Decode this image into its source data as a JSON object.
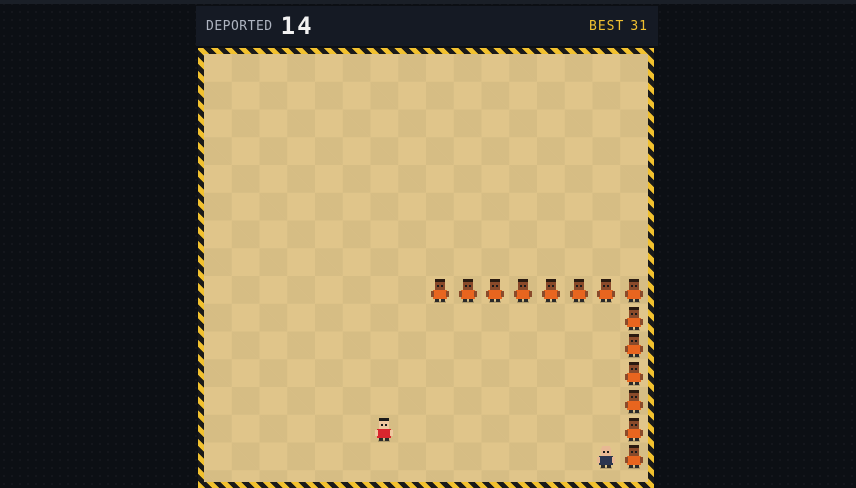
{
  "hud": {
    "score_label": "DEPORTED",
    "score_value": "14",
    "best_label": "BEST",
    "best_value": "31"
  },
  "colors": {
    "hazard_yellow": "#f2c12e",
    "best_text": "#f0c030",
    "sand": "#e0c58a",
    "prisoner_orange": "#e8651f",
    "player_red": "#d9262e"
  },
  "game": {
    "grid_cols": 16,
    "grid_rows": 16,
    "player": {
      "col": 6,
      "row": 13,
      "icon": "player-red-shirt-icon"
    },
    "guard": {
      "col": 14,
      "row": 14,
      "icon": "bald-guard-icon"
    },
    "chain": [
      {
        "col": 8,
        "row": 8,
        "hair": "dark"
      },
      {
        "col": 9,
        "row": 8,
        "hair": "dark"
      },
      {
        "col": 10,
        "row": 8,
        "hair": "dark"
      },
      {
        "col": 11,
        "row": 8,
        "hair": "dark"
      },
      {
        "col": 12,
        "row": 8,
        "hair": "dark"
      },
      {
        "col": 13,
        "row": 8,
        "hair": "dark"
      },
      {
        "col": 14,
        "row": 8,
        "hair": "dark"
      },
      {
        "col": 15,
        "row": 8,
        "hair": "dark"
      },
      {
        "col": 15,
        "row": 9,
        "hair": "dark"
      },
      {
        "col": 15,
        "row": 10,
        "hair": "dark"
      },
      {
        "col": 15,
        "row": 11,
        "hair": "dark"
      },
      {
        "col": 15,
        "row": 12,
        "hair": "dark"
      },
      {
        "col": 15,
        "row": 13,
        "hair": "dark"
      },
      {
        "col": 15,
        "row": 14,
        "hair": "dark"
      }
    ]
  }
}
